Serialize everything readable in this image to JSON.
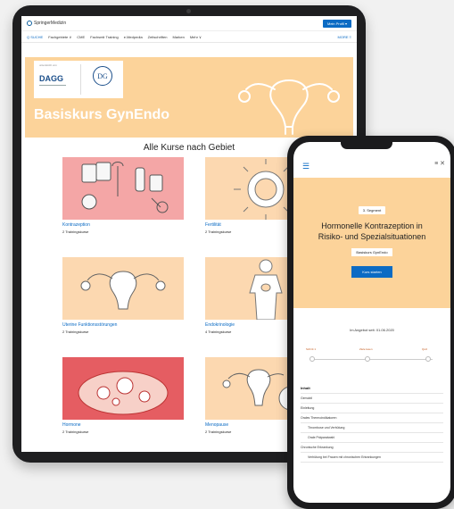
{
  "tablet": {
    "header": {
      "logo": "SpringerMedizin",
      "login_button": "Mein Profil ▾"
    },
    "nav": {
      "items": [
        "Q SUCHE",
        "Fachgebiete ∨",
        "CME",
        "Fachsmit Training",
        "e.Medpedia",
        "Zeitschriften",
        "Marken",
        "Mehr ∨"
      ],
      "more": "MORE ≡"
    },
    "hero": {
      "sponsor_caption": "unterstützt von",
      "sponsor_logo_1": "DAGG",
      "sponsor_logo_2": "DG",
      "title": "Basiskurs GynEndo"
    },
    "grid_title": "Alle Kurse nach Gebiet",
    "cards": [
      {
        "title": "Kontrazeption",
        "subtitle": "2 Trainingskurse"
      },
      {
        "title": "Fertilität",
        "subtitle": "2 Trainingskurse"
      },
      {
        "title": "Uterine Funktionsstörungen",
        "subtitle": "2 Trainingskurse"
      },
      {
        "title": "Endokrinologie",
        "subtitle": "4 Trainingskurse"
      },
      {
        "title": "Hormone",
        "subtitle": "2 Trainingskurse"
      },
      {
        "title": "Menopause",
        "subtitle": "2 Trainingskurse"
      }
    ]
  },
  "phone": {
    "icons": "≡   ✕",
    "badge": "3. Segment",
    "title_line1": "Hormonelle Kontrazeption in",
    "title_line2": "Risiko- und Spezialsituationen",
    "badge2": "Basiskurs GynEndo",
    "start_button": "Kurs starten",
    "availability": "Im Angebot seit: 01.06.2020",
    "steps": [
      "Schritt 1",
      "Ziele lesen",
      "Quiz"
    ],
    "toc": [
      {
        "text": "Inhalt",
        "kind": "head"
      },
      {
        "text": "Gemobil",
        "kind": "row"
      },
      {
        "text": "Einleitung",
        "kind": "row"
      },
      {
        "text": "Orales Thermoindikatoren",
        "kind": "row"
      },
      {
        "text": "Thrombose und Verhütung",
        "kind": "sub"
      },
      {
        "text": "Orale Präparatwahl",
        "kind": "sub"
      },
      {
        "text": "Chronische Erkrankung",
        "kind": "row"
      },
      {
        "text": "Verhütung bei Frauen mit chronischen Erkrankungen",
        "kind": "sub"
      }
    ]
  },
  "colors": {
    "hero_bg": "#fcd39a",
    "accent": "#0b6bc4",
    "card_pink": "#f4a6a6",
    "card_peach": "#fcd8b0",
    "card_red": "#e55d62"
  }
}
